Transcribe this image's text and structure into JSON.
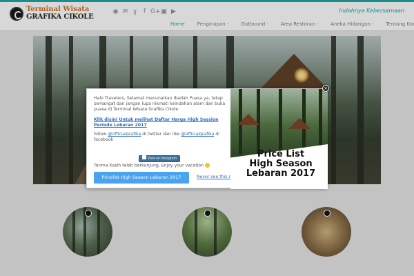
{
  "header": {
    "logo_line1": "Terminal Wisata",
    "logo_line2": "GRAFIKA CIKOLE",
    "tagline": "Indahnya Kebersamaan",
    "social_icons": [
      "rss-icon",
      "envelope-icon",
      "twitter-icon",
      "facebook-icon",
      "google-plus-icon",
      "instagram-icon",
      "youtube-icon"
    ]
  },
  "nav": {
    "items": [
      {
        "label": "Home"
      },
      {
        "label": "Penginapan -"
      },
      {
        "label": "Outbound -"
      },
      {
        "label": "Area Restoran -"
      },
      {
        "label": "Aneka Hidangan -"
      },
      {
        "label": "Tentang Kami -"
      }
    ],
    "active_index": 0
  },
  "popup": {
    "greeting": "Halo Travelers, Selamat menunaikan Ibadah Puasa ya, tetap semangat dan jangan lupa nikmati keindahan alam dan buka puasa di Terminal Wisata Grafika Cikole",
    "link_text": "Klik disini Untuk melihat Daftar Harga High Session Periode Lebaran 2017",
    "follow_prefix": "follow",
    "follow_twitter": "@officialgrafika",
    "follow_middle": "di twitter dan like",
    "follow_facebook": "@officialgrafika",
    "follow_suffix": "di facebook",
    "instagram_label": "View on Instagram",
    "thanks": "Terima Kasih telah berkunjung, Enjoy your vacation",
    "pricelist_button": "Pricelist High Season Lebaran 2017",
    "never_link": "Never see this mess",
    "image_line1": "Price List",
    "image_line2": "High Season",
    "image_line3": "Lebaran 2017",
    "close_symbol": "×"
  },
  "colors": {
    "accent": "#1aa3a3",
    "link": "#2b6db5",
    "button": "#4aa3f0"
  }
}
